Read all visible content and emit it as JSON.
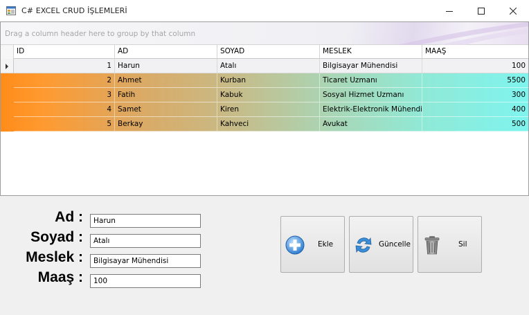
{
  "window": {
    "title": "C# EXCEL CRUD İŞLEMLERİ"
  },
  "grid": {
    "group_panel_text": "Drag a column header here to group by that column",
    "columns": [
      "ID",
      "AD",
      "SOYAD",
      "MESLEK",
      "MAAŞ"
    ],
    "rows": [
      {
        "id": "1",
        "ad": "Harun",
        "soyad": "Atalı",
        "meslek": "Bilgisayar Mühendisi",
        "maas": "100"
      },
      {
        "id": "2",
        "ad": "Ahmet",
        "soyad": "Kurban",
        "meslek": "Ticaret Uzmanı",
        "maas": "5500"
      },
      {
        "id": "3",
        "ad": "Fatih",
        "soyad": "Kabuk",
        "meslek": "Sosyal Hizmet Uzmanı",
        "maas": "300"
      },
      {
        "id": "4",
        "ad": "Samet",
        "soyad": "Kiren",
        "meslek": "Elektrik-Elektronik Mühendisi",
        "maas": "400"
      },
      {
        "id": "5",
        "ad": "Berkay",
        "soyad": "Kahveci",
        "meslek": "Avukat",
        "maas": "500"
      }
    ]
  },
  "form": {
    "labels": {
      "ad": "Ad :",
      "soyad": "Soyad :",
      "meslek": "Meslek :",
      "maas": "Maaş :"
    },
    "values": {
      "ad": "Harun",
      "soyad": "Atalı",
      "meslek": "Bilgisayar Mühendisi",
      "maas": "100"
    }
  },
  "actions": {
    "add_label": "Ekle",
    "update_label": "Güncelle",
    "delete_label": "Sil"
  },
  "colors": {
    "row_gradient_start": "#ff8c1a",
    "row_gradient_end": "#7ef4ee",
    "selected_row": "#f1f1f4"
  }
}
